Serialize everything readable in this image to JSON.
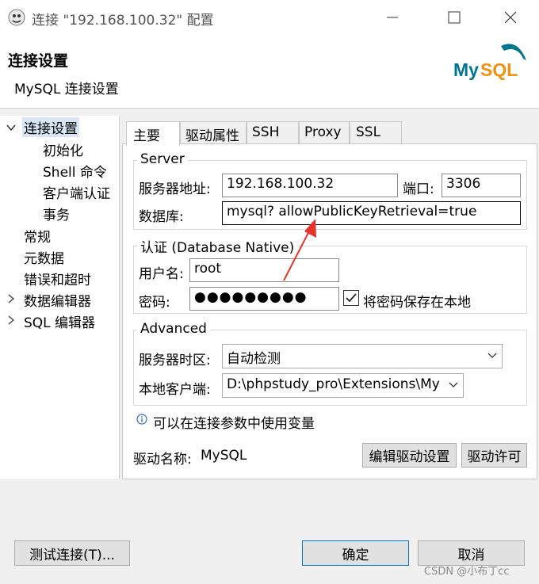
{
  "window": {
    "title": "连接 \"192.168.100.32\" 配置",
    "minimize_icon": "minimize-icon",
    "maximize_icon": "maximize-icon",
    "close_icon": "close-icon"
  },
  "header": {
    "title": "连接设置",
    "subtitle": "MySQL 连接设置",
    "logo_text": "MySQL"
  },
  "nav": {
    "items": [
      {
        "label": "连接设置",
        "expanded": true,
        "selected": true
      },
      {
        "label": "初始化"
      },
      {
        "label": "Shell 命令"
      },
      {
        "label": "客户端认证"
      },
      {
        "label": "事务"
      },
      {
        "label": "常规"
      },
      {
        "label": "元数据"
      },
      {
        "label": "错误和超时"
      },
      {
        "label": "数据编辑器",
        "expandable": true
      },
      {
        "label": "SQL 编辑器",
        "expandable": true
      }
    ]
  },
  "tabs": [
    {
      "label": "主要",
      "active": true
    },
    {
      "label": "驱动属性"
    },
    {
      "label": "SSH"
    },
    {
      "label": "Proxy"
    },
    {
      "label": "SSL"
    }
  ],
  "server": {
    "group_title": "Server",
    "host_label": "服务器地址:",
    "host_value": "192.168.100.32",
    "port_label": "端口:",
    "port_value": "3306",
    "db_label": "数据库:",
    "db_value": "mysql? allowPublicKeyRetrieval=true"
  },
  "auth": {
    "group_title": "认证 (Database Native)",
    "user_label": "用户名:",
    "user_value": "root",
    "password_label": "密码:",
    "password_value": "●●●●●●●●●",
    "save_password_label": "将密码保存在本地",
    "save_password_checked": true
  },
  "advanced": {
    "group_title": "Advanced",
    "timezone_label": "服务器时区:",
    "timezone_value": "自动检测",
    "client_label": "本地客户端:",
    "client_value": "D:\\phpstudy_pro\\Extensions\\My"
  },
  "info": {
    "icon": "info-icon",
    "text": "可以在连接参数中使用变量"
  },
  "driver": {
    "label": "驱动名称:",
    "value": "MySQL",
    "edit_button": "编辑驱动设置",
    "license_button": "驱动许可"
  },
  "footer": {
    "test_button": "测试连接(T)...",
    "ok_button": "确定",
    "cancel_button": "取消"
  },
  "watermark": "CSDN @小布丁cc",
  "colors": {
    "arrow": "#e8322b",
    "mysql_blue": "#00758f",
    "mysql_orange": "#f29111",
    "selection": "#d9e6f5"
  }
}
